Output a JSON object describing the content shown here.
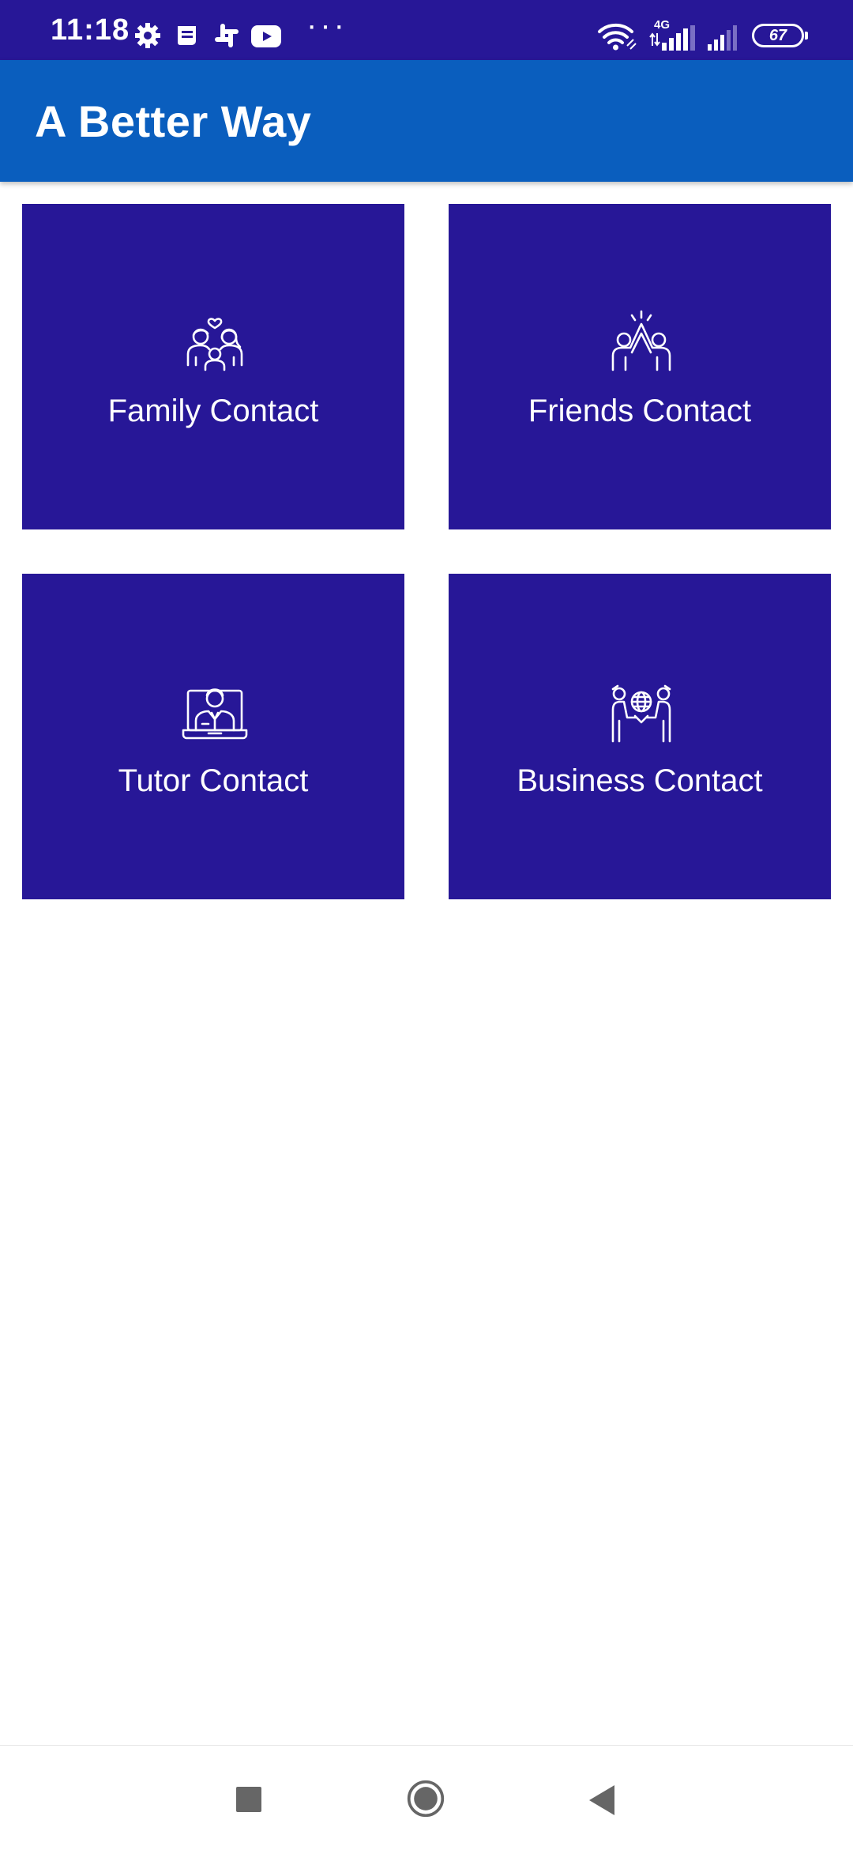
{
  "status_bar": {
    "time": "11:18",
    "more_indicator": "···",
    "battery_level": "67",
    "network_type": "4G",
    "notification_icons": [
      "gear-icon",
      "news-icon",
      "slack-icon",
      "youtube-icon"
    ],
    "system_icons": [
      "wifi-icon",
      "signal-4g-icon",
      "signal-icon",
      "battery-icon"
    ],
    "background_color": "#271797"
  },
  "app_bar": {
    "title": "A Better Way",
    "background_color": "#0a5ebe"
  },
  "cards": [
    {
      "label": "Family Contact",
      "icon": "family-icon"
    },
    {
      "label": "Friends Contact",
      "icon": "high-five-icon"
    },
    {
      "label": "Tutor Contact",
      "icon": "online-tutor-icon"
    },
    {
      "label": "Business Contact",
      "icon": "business-handshake-icon"
    }
  ],
  "card_color": "#271797",
  "nav_bar": {
    "buttons": [
      "recents-square-icon",
      "home-circle-icon",
      "back-triangle-icon"
    ]
  }
}
